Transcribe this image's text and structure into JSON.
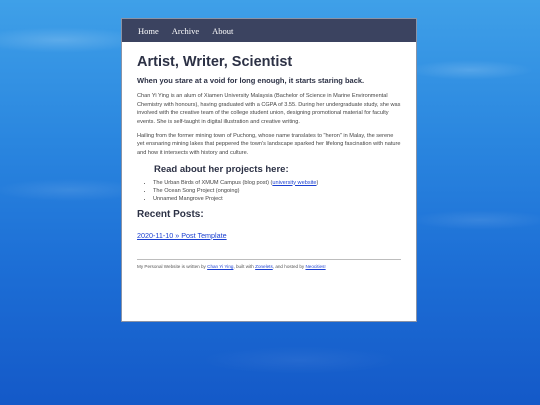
{
  "nav": {
    "items": [
      {
        "label": "Home"
      },
      {
        "label": "Archive"
      },
      {
        "label": "About"
      }
    ]
  },
  "main": {
    "title": "Artist, Writer, Scientist",
    "tagline": "When you stare at a void for long enough, it starts staring back.",
    "paragraphs": [
      "Chan Yi Ying is an alum of Xiamen University Malaysia (Bachelor of Science in Marine Environmental Chemistry with honours), having graduated with a CGPA of 3.55. During her undergraduate study, she was involved with the creative team of the college student union, designing promotional material for faculty events. She is self-taught in digital illustration and creative writing.",
      "Hailing from the former mining town of Puchong, whose name translates to \"heron\" in Malay, the serene yet ensnaring mining lakes that peppered the town's landscape sparked her lifelong fascination with nature and how it intersects with history and culture."
    ],
    "projects_heading": "Read about her projects here:",
    "projects": [
      {
        "text": "The Urban Birds of XMUM Campus (blog post) (",
        "link": "university website",
        "suffix": ")"
      },
      {
        "text": "The Ocean Song Project (ongoing)"
      },
      {
        "text": "Unnamed Mangrove Project"
      }
    ],
    "recent_heading": "Recent Posts:",
    "recent_post": "2020-11-10 » Post Template"
  },
  "footer": {
    "prefix": "My Personal Website is written by ",
    "author": "Chan Yi Ying",
    "mid1": ", built with ",
    "builder": "Zonelets",
    "mid2": ", and hosted by ",
    "host": "Neocities!"
  },
  "colors": {
    "nav_bg": "#3b4360",
    "link": "#1a3fd1",
    "heading": "#2c3145",
    "background_top": "#3fa0e8",
    "background_bottom": "#1459c8"
  }
}
